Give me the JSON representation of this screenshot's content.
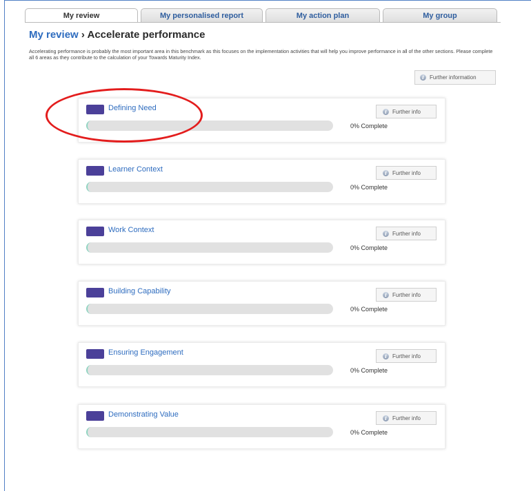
{
  "tabs": [
    {
      "label": "My review",
      "active": true
    },
    {
      "label": "My personalised report",
      "active": false
    },
    {
      "label": "My action plan",
      "active": false
    },
    {
      "label": "My group",
      "active": false
    }
  ],
  "header": {
    "breadcrumb": "My review",
    "separator": " › ",
    "title": "Accelerate performance",
    "description": "Accelerating performance is probably the most important area in this benchmark as this focuses on the implementation activities that will help you improve performance in all of the other sections. Please complete all 6 areas as they contribute to the calculation of your Towards Maturity Index.",
    "further_information_label": "Further information"
  },
  "areas": [
    {
      "name": "Defining Need",
      "progress": 0,
      "progress_text": "0% Complete",
      "info_label": "Further info"
    },
    {
      "name": "Learner Context",
      "progress": 0,
      "progress_text": "0% Complete",
      "info_label": "Further info"
    },
    {
      "name": "Work Context",
      "progress": 0,
      "progress_text": "0% Complete",
      "info_label": "Further info"
    },
    {
      "name": "Building Capability",
      "progress": 0,
      "progress_text": "0% Complete",
      "info_label": "Further info"
    },
    {
      "name": "Ensuring Engagement",
      "progress": 0,
      "progress_text": "0% Complete",
      "info_label": "Further info"
    },
    {
      "name": "Demonstrating Value",
      "progress": 0,
      "progress_text": "0% Complete",
      "info_label": "Further info"
    }
  ],
  "icons": {
    "info": "info-icon",
    "info_glyph": "i"
  },
  "colors": {
    "link": "#2e6cbf",
    "swatch": "#4b4099",
    "progress_fill": "#8fd4c1",
    "highlight": "#e31d1d"
  }
}
